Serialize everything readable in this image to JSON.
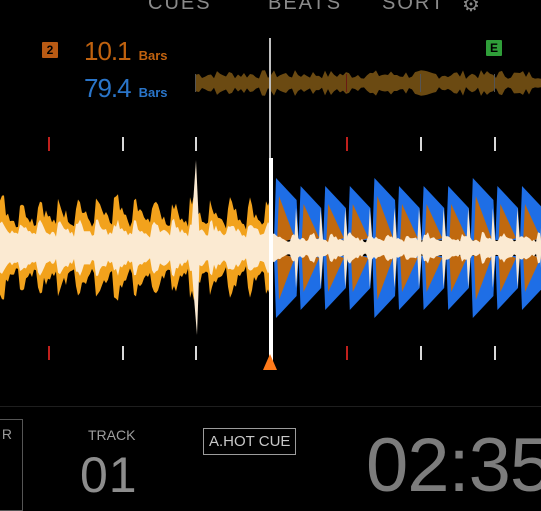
{
  "header": {
    "menu_items": [
      "CUES",
      "BEATS",
      "SORT",
      "⚙"
    ]
  },
  "deck_info": {
    "deck_tag": "2",
    "deck_tag_color": "#b85a14",
    "remaining_bars": "10.1",
    "remaining_unit": "Bars",
    "remaining_color": "#c0620f",
    "elapsed_bars": "79.4",
    "elapsed_unit": "Bars",
    "elapsed_color": "#2a75c9",
    "end_marker": "E",
    "end_marker_color": "#2f9e39"
  },
  "waveform": {
    "colors": {
      "orange": "#f2a21c",
      "blue": "#1e6ee6",
      "dark_orange": "#c0690f",
      "cream": "#fbead2",
      "marker_red": "#c0201c",
      "marker_white": "#d9d9d9",
      "playhead": "#ffffff",
      "playhead_triangle": "#ff7a1a"
    }
  },
  "bottom": {
    "left_label": "R",
    "track_label": "TRACK",
    "track_number": "01",
    "hotcue_button": "A.HOT CUE",
    "time": "02:35"
  }
}
